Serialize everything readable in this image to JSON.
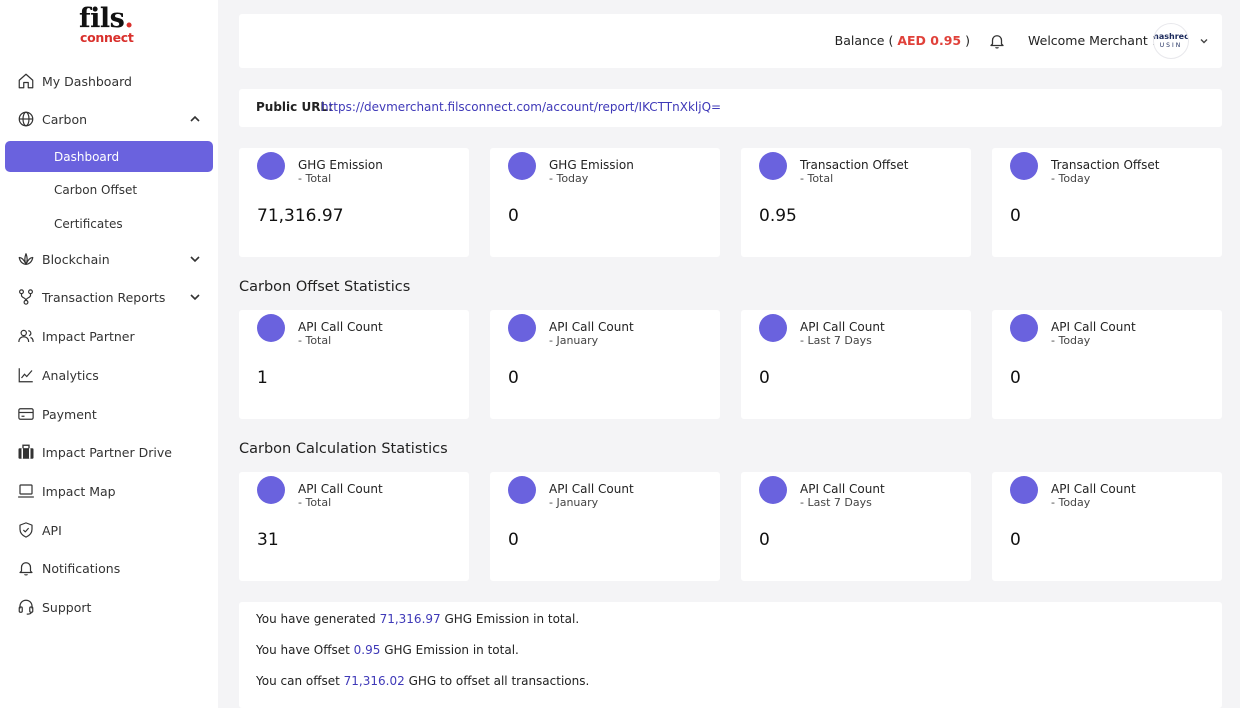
{
  "brand": {
    "logo_line1": "fils",
    "logo_dot": ".",
    "logo_line2": "connect"
  },
  "sidebar": {
    "items": [
      {
        "label": "My Dashboard",
        "icon": "home-icon"
      },
      {
        "label": "Carbon",
        "icon": "globe-icon",
        "expanded": true
      },
      {
        "label": "Blockchain",
        "icon": "lotus-icon"
      },
      {
        "label": "Transaction Reports",
        "icon": "flow-icon"
      },
      {
        "label": "Impact Partner",
        "icon": "users-icon"
      },
      {
        "label": "Analytics",
        "icon": "chart-line-icon"
      },
      {
        "label": "Payment",
        "icon": "card-icon"
      },
      {
        "label": "Impact Partner Drive",
        "icon": "briefcase-icon"
      },
      {
        "label": "Impact Map",
        "icon": "laptop-icon"
      },
      {
        "label": "API",
        "icon": "shield-icon"
      },
      {
        "label": "Notifications",
        "icon": "bell-icon"
      },
      {
        "label": "Support",
        "icon": "headset-icon"
      }
    ],
    "carbon_sub": [
      {
        "label": "Dashboard",
        "active": true
      },
      {
        "label": "Carbon Offset"
      },
      {
        "label": "Certificates"
      }
    ]
  },
  "header": {
    "balance_prefix": "Balance (",
    "balance_amount": "AED 0.95",
    "balance_suffix": ")",
    "welcome": "Welcome Merchant 1",
    "avatar_top": "nashrec",
    "avatar_bottom": "USIN"
  },
  "public_url": {
    "label": "Public URL:",
    "value": "https://devmerchant.filsconnect.com/account/report/IKCTTnXkljQ="
  },
  "top_cards": [
    {
      "title": "GHG Emission",
      "sub": "- Total",
      "value": "71,316.97"
    },
    {
      "title": "GHG Emission",
      "sub": "- Today",
      "value": "0"
    },
    {
      "title": "Transaction Offset",
      "sub": "- Total",
      "value": "0.95"
    },
    {
      "title": "Transaction Offset",
      "sub": "- Today",
      "value": "0"
    }
  ],
  "offset_stats": {
    "title": "Carbon Offset Statistics",
    "cards": [
      {
        "title": "API Call Count",
        "sub": "- Total",
        "value": "1"
      },
      {
        "title": "API Call Count",
        "sub": "- January",
        "value": "0"
      },
      {
        "title": "API Call Count",
        "sub": "- Last 7 Days",
        "value": "0"
      },
      {
        "title": "API Call Count",
        "sub": "- Today",
        "value": "0"
      }
    ]
  },
  "calc_stats": {
    "title": "Carbon Calculation Statistics",
    "cards": [
      {
        "title": "API Call Count",
        "sub": "- Total",
        "value": "31"
      },
      {
        "title": "API Call Count",
        "sub": "- January",
        "value": "0"
      },
      {
        "title": "API Call Count",
        "sub": "- Last 7 Days",
        "value": "0"
      },
      {
        "title": "API Call Count",
        "sub": "- Today",
        "value": "0"
      }
    ]
  },
  "summary": {
    "l1_pre": "You have generated",
    "l1_num": "71,316.97",
    "l1_post": "GHG Emission in total.",
    "l2_pre": "You have Offset",
    "l2_num": "0.95",
    "l2_post": "GHG Emission in total.",
    "l3_pre": "You can offset",
    "l3_num": "71,316.02",
    "l3_post": "GHG to offset all transactions."
  },
  "colors": {
    "accent": "#6a62de",
    "link": "#3f39b8",
    "balance": "#e0413a",
    "brand_red": "#d9302c"
  }
}
